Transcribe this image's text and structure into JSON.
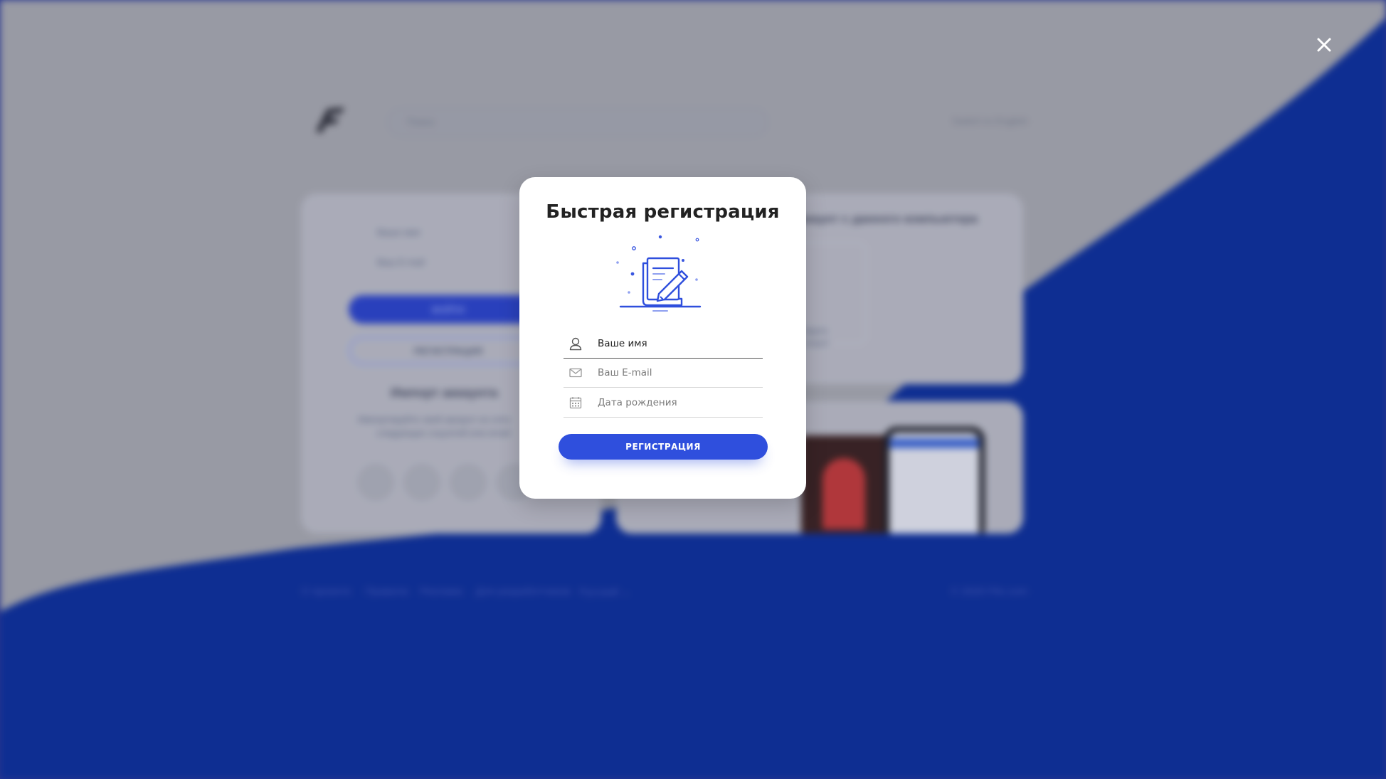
{
  "background_page": {
    "search_placeholder": "Поиск",
    "top_right_link": "Switch to English",
    "login_form": {
      "name_placeholder": "Ваше имя",
      "email_placeholder": "Ваш E-mail",
      "login_button": "ВОЙТИ",
      "register_button": "РЕГИСТРАЦИЯ",
      "import_title": "Импорт аккаунта",
      "import_text_line1": "Импортируйте свой аккаунт из сети",
      "import_text_line2": "следующих соцсетей или email"
    },
    "right_card_title": "ккаунт с данного компьютера",
    "right_card_caption_line1": "йдите",
    "right_card_caption_line2": "ккаунт",
    "footer": {
      "links": [
        "О проекте",
        "Правила",
        "Реклама",
        "Для разработчиков",
        "Русский ⌄"
      ],
      "copyright": "© 2020 Flix.com"
    }
  },
  "modal": {
    "title": "Быстрая регистрация",
    "fields": {
      "name_placeholder": "Ваше имя",
      "email_placeholder": "Ваш E-mail",
      "birthdate_placeholder": "Дата рождения"
    },
    "submit_label": "РЕГИСТРАЦИЯ"
  },
  "colors": {
    "accent": "#2f4fdd",
    "background_blue": "#0b2f9c",
    "background_gray": "#a7a9b0",
    "modal_bg": "#ffffff"
  },
  "icons": {
    "close": "close-icon",
    "name": "user-icon",
    "email": "mail-icon",
    "birthdate": "calendar-icon",
    "illustration": "document-edit-illustration"
  }
}
